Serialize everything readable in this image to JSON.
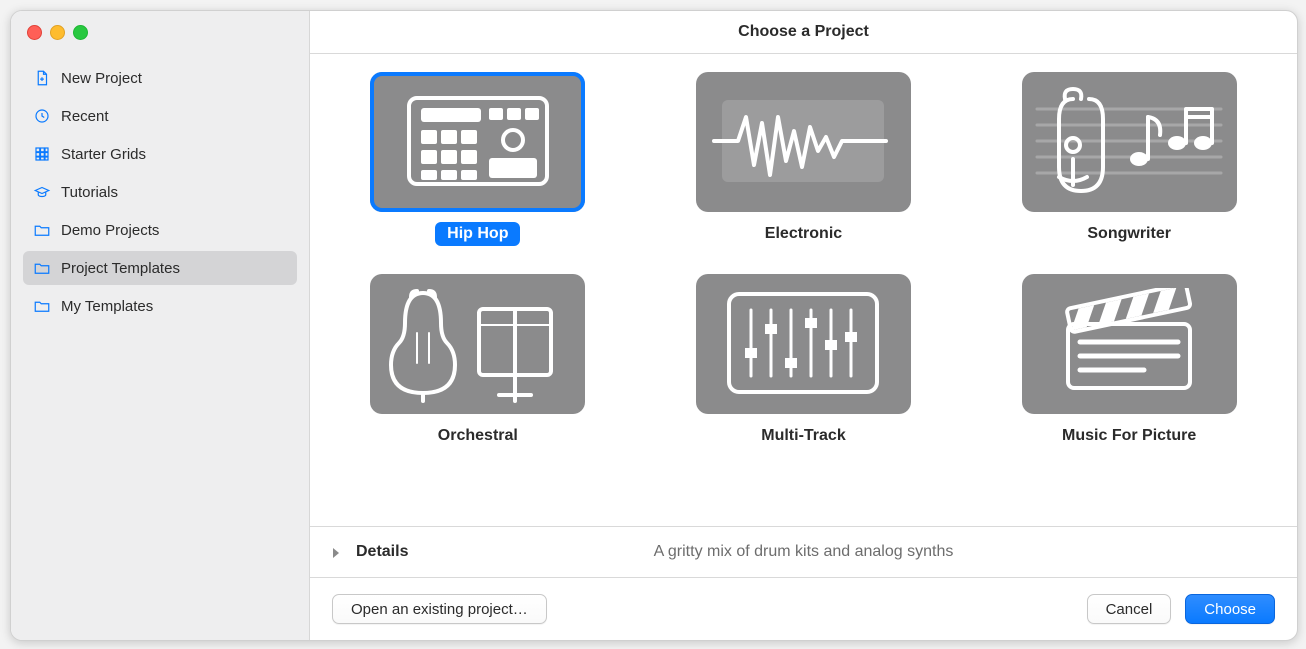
{
  "header": {
    "title": "Choose a Project"
  },
  "sidebar": {
    "items": [
      {
        "label": "New Project",
        "icon": "doc-new-icon"
      },
      {
        "label": "Recent",
        "icon": "clock-icon"
      },
      {
        "label": "Starter Grids",
        "icon": "grid-icon"
      },
      {
        "label": "Tutorials",
        "icon": "grad-cap-icon"
      },
      {
        "label": "Demo Projects",
        "icon": "folder-icon"
      },
      {
        "label": "Project Templates",
        "icon": "folder-icon",
        "selected": true
      },
      {
        "label": "My Templates",
        "icon": "folder-icon"
      }
    ]
  },
  "templates": [
    {
      "label": "Hip Hop",
      "icon": "drum-machine-icon",
      "selected": true
    },
    {
      "label": "Electronic",
      "icon": "waveform-icon"
    },
    {
      "label": "Songwriter",
      "icon": "guitar-notes-icon"
    },
    {
      "label": "Orchestral",
      "icon": "orchestra-icon"
    },
    {
      "label": "Multi-Track",
      "icon": "mixer-icon"
    },
    {
      "label": "Music For Picture",
      "icon": "clapper-icon"
    }
  ],
  "details": {
    "label": "Details",
    "description": "A gritty mix of drum kits and analog synths"
  },
  "buttons": {
    "open_existing": "Open an existing project…",
    "cancel": "Cancel",
    "choose": "Choose"
  }
}
